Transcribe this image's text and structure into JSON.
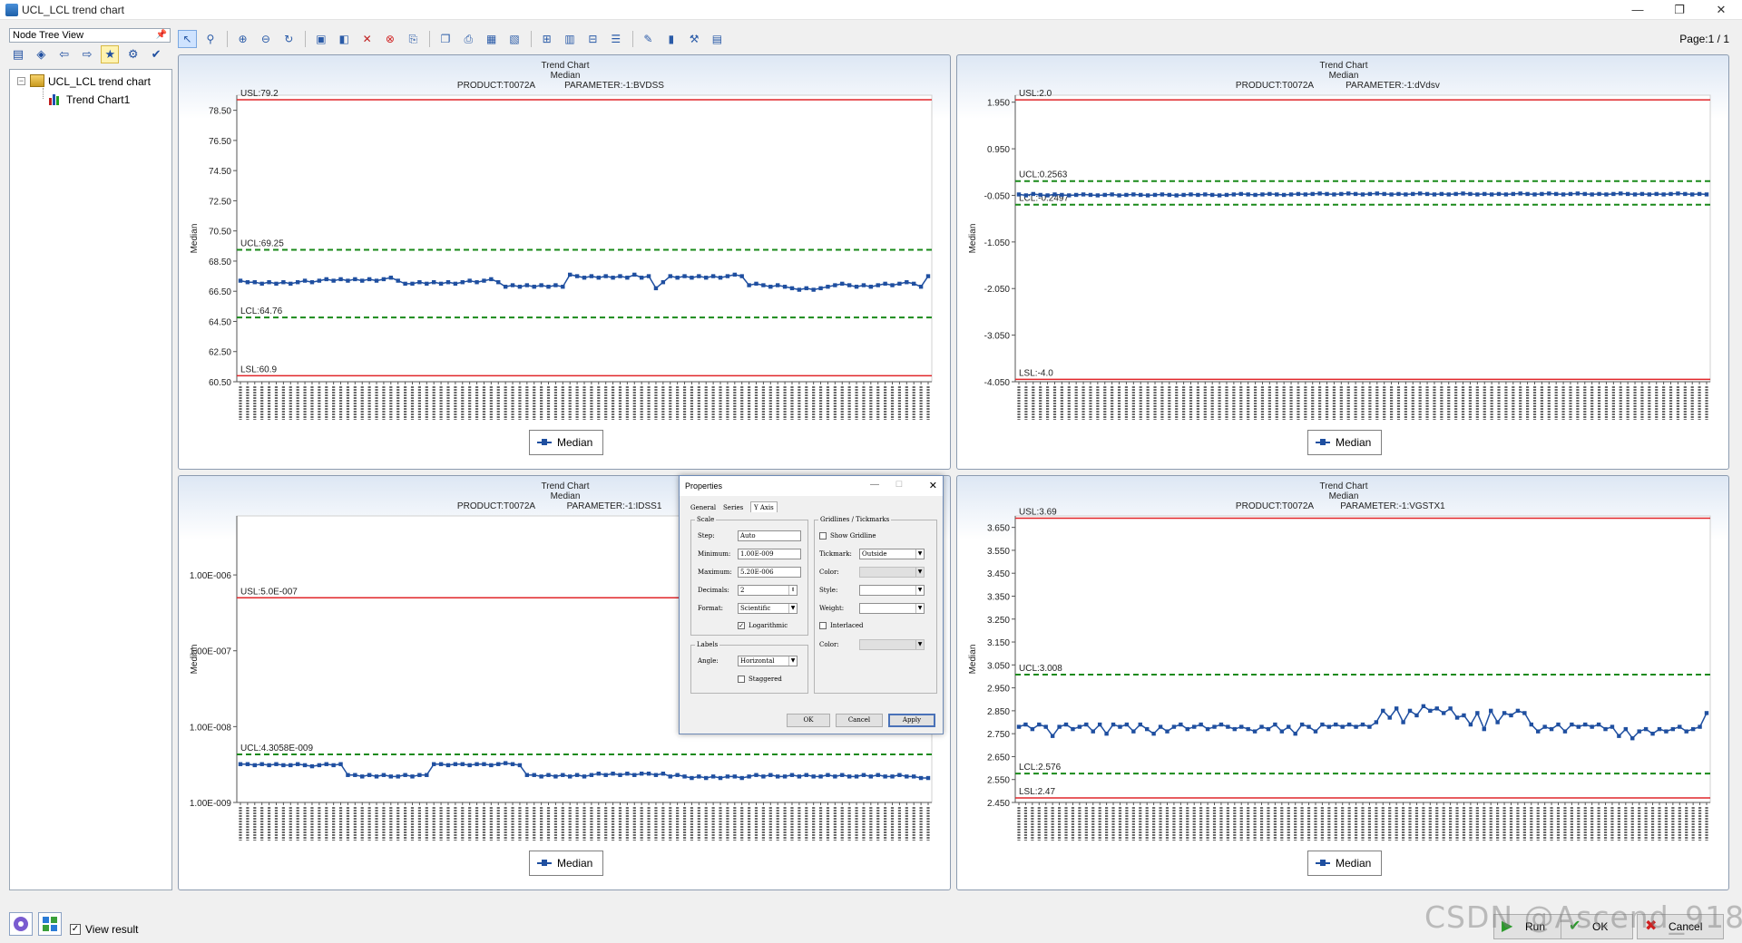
{
  "window": {
    "title": "UCL_LCL trend chart",
    "controls": [
      "—",
      "❐",
      "✕"
    ]
  },
  "tree": {
    "header": "Node Tree View",
    "pin": "📌",
    "root": "UCL_LCL trend chart",
    "child": "Trend Chart1",
    "expander": "−"
  },
  "page_label": "Page:1 / 1",
  "colors": {
    "usl": "#e0262a",
    "ucl": "#1a8a1a",
    "series": "#1f4fa0",
    "axis": "#333333"
  },
  "legend_label": "Median",
  "charts": [
    {
      "title": "Trend Chart",
      "subtitle": "Median",
      "product": "PRODUCT:T0072A",
      "parameter": "PARAMETER:-1:BVDSS",
      "ylabel": "Median",
      "yticks": [
        "78.50",
        "76.50",
        "74.50",
        "72.50",
        "70.50",
        "68.50",
        "66.50",
        "64.50",
        "62.50",
        "60.50"
      ],
      "labels": {
        "usl": "USL:79.2",
        "ucl": "UCL:69.25",
        "lcl": "LCL:64.76",
        "lsl": "LSL:60.9"
      }
    },
    {
      "title": "Trend Chart",
      "subtitle": "Median",
      "product": "PRODUCT:T0072A",
      "parameter": "PARAMETER:-1:dVdsv",
      "ylabel": "Median",
      "yticks": [
        "1.950",
        "0.950",
        "-0.050",
        "-1.050",
        "-2.050",
        "-3.050",
        "-4.050"
      ],
      "labels": {
        "usl": "USL:2.0",
        "ucl": "UCL:0.2563",
        "lcl": "LCL:-0.2497",
        "lsl": "LSL:-4.0"
      }
    },
    {
      "title": "Trend Chart",
      "subtitle": "Median",
      "product": "PRODUCT:T0072A",
      "parameter": "PARAMETER:-1:IDSS1",
      "ylabel": "Median",
      "yticks": [
        "1.00E-006",
        "1.00E-007",
        "1.00E-008",
        "1.00E-009"
      ],
      "labels": {
        "usl": "USL:5.0E-007",
        "ucl": "UCL:4.3058E-009",
        "lcl": "",
        "lsl": ""
      }
    },
    {
      "title": "Trend Chart",
      "subtitle": "Median",
      "product": "PRODUCT:T0072A",
      "parameter": "PARAMETER:-1:VGSTX1",
      "ylabel": "Median",
      "yticks": [
        "3.650",
        "3.550",
        "3.450",
        "3.350",
        "3.250",
        "3.150",
        "3.050",
        "2.950",
        "2.850",
        "2.750",
        "2.650",
        "2.550",
        "2.450"
      ],
      "labels": {
        "usl": "USL:3.69",
        "ucl": "UCL:3.008",
        "lcl": "LCL:2.576",
        "lsl": "LSL:2.47"
      }
    }
  ],
  "chart_data": [
    {
      "type": "line",
      "title": "Trend Chart",
      "subtitle": "Median",
      "ylabel": "Median",
      "ylim": [
        60.5,
        79.5
      ],
      "limits": {
        "usl": 79.2,
        "ucl": 69.25,
        "lcl": 64.76,
        "lsl": 60.9
      },
      "series": [
        {
          "name": "Median",
          "values": [
            67.2,
            67.1,
            67.1,
            67.0,
            67.1,
            67.0,
            67.1,
            67.0,
            67.1,
            67.2,
            67.1,
            67.2,
            67.3,
            67.2,
            67.3,
            67.2,
            67.3,
            67.2,
            67.3,
            67.2,
            67.3,
            67.4,
            67.2,
            67.0,
            67.0,
            67.1,
            67.0,
            67.1,
            67.0,
            67.1,
            67.0,
            67.1,
            67.2,
            67.1,
            67.2,
            67.3,
            67.1,
            66.8,
            66.9,
            66.8,
            66.9,
            66.8,
            66.9,
            66.8,
            66.9,
            66.8,
            67.6,
            67.5,
            67.4,
            67.5,
            67.4,
            67.5,
            67.4,
            67.5,
            67.4,
            67.6,
            67.4,
            67.5,
            66.7,
            67.1,
            67.5,
            67.4,
            67.5,
            67.4,
            67.5,
            67.4,
            67.5,
            67.4,
            67.5,
            67.6,
            67.5,
            66.9,
            67.0,
            66.9,
            66.8,
            66.9,
            66.8,
            66.7,
            66.6,
            66.7,
            66.6,
            66.7,
            66.8,
            66.9,
            67.0,
            66.9,
            66.8,
            66.9,
            66.8,
            66.9,
            67.0,
            66.9,
            67.0,
            67.1,
            67.0,
            66.8,
            67.5
          ]
        }
      ]
    },
    {
      "type": "line",
      "title": "Trend Chart",
      "subtitle": "Median",
      "ylabel": "Median",
      "ylim": [
        -4.05,
        2.1
      ],
      "limits": {
        "usl": 2.0,
        "ucl": 0.2563,
        "lcl": -0.2497,
        "lsl": -4.0
      },
      "series": [
        {
          "name": "Median",
          "values": [
            -0.03,
            -0.05,
            -0.02,
            -0.04,
            -0.05,
            -0.03,
            -0.04,
            -0.05,
            -0.04,
            -0.03,
            -0.04,
            -0.05,
            -0.04,
            -0.03,
            -0.05,
            -0.04,
            -0.03,
            -0.04,
            -0.05,
            -0.04,
            -0.03,
            -0.04,
            -0.05,
            -0.04,
            -0.03,
            -0.04,
            -0.03,
            -0.04,
            -0.05,
            -0.04,
            -0.03,
            -0.02,
            -0.03,
            -0.04,
            -0.03,
            -0.02,
            -0.03,
            -0.04,
            -0.03,
            -0.02,
            -0.03,
            -0.02,
            -0.01,
            -0.02,
            -0.03,
            -0.02,
            -0.01,
            -0.02,
            -0.03,
            -0.02,
            -0.01,
            -0.02,
            -0.03,
            -0.02,
            -0.03,
            -0.02,
            -0.01,
            -0.02,
            -0.03,
            -0.02,
            -0.03,
            -0.02,
            -0.01,
            -0.02,
            -0.03,
            -0.02,
            -0.03,
            -0.02,
            -0.03,
            -0.02,
            -0.01,
            -0.02,
            -0.03,
            -0.02,
            -0.01,
            -0.02,
            -0.03,
            -0.02,
            -0.01,
            -0.02,
            -0.03,
            -0.02,
            -0.03,
            -0.02,
            -0.01,
            -0.02,
            -0.03,
            -0.02,
            -0.03,
            -0.02,
            -0.03,
            -0.02,
            -0.01,
            -0.02,
            -0.03,
            -0.02,
            -0.03
          ]
        }
      ]
    },
    {
      "type": "line",
      "title": "Trend Chart",
      "subtitle": "Median",
      "ylabel": "Median",
      "yscale": "log",
      "ylim": [
        1e-09,
        6e-06
      ],
      "limits": {
        "usl": 5e-07,
        "ucl": 4.3058e-09
      },
      "series": [
        {
          "name": "Median",
          "values": [
            3.2e-09,
            3.2e-09,
            3.1e-09,
            3.2e-09,
            3.1e-09,
            3.2e-09,
            3.1e-09,
            3.1e-09,
            3.2e-09,
            3.1e-09,
            3e-09,
            3.1e-09,
            3.2e-09,
            3.1e-09,
            3.2e-09,
            2.3e-09,
            2.3e-09,
            2.2e-09,
            2.3e-09,
            2.2e-09,
            2.3e-09,
            2.2e-09,
            2.2e-09,
            2.3e-09,
            2.2e-09,
            2.3e-09,
            2.3e-09,
            3.2e-09,
            3.2e-09,
            3.1e-09,
            3.2e-09,
            3.2e-09,
            3.1e-09,
            3.2e-09,
            3.2e-09,
            3.1e-09,
            3.2e-09,
            3.3e-09,
            3.2e-09,
            3.1e-09,
            2.3e-09,
            2.3e-09,
            2.2e-09,
            2.3e-09,
            2.2e-09,
            2.3e-09,
            2.2e-09,
            2.3e-09,
            2.2e-09,
            2.3e-09,
            2.4e-09,
            2.3e-09,
            2.4e-09,
            2.3e-09,
            2.4e-09,
            2.3e-09,
            2.4e-09,
            2.4e-09,
            2.3e-09,
            2.4e-09,
            2.2e-09,
            2.3e-09,
            2.2e-09,
            2.1e-09,
            2.2e-09,
            2.1e-09,
            2.2e-09,
            2.1e-09,
            2.2e-09,
            2.2e-09,
            2.1e-09,
            2.2e-09,
            2.3e-09,
            2.2e-09,
            2.3e-09,
            2.2e-09,
            2.2e-09,
            2.3e-09,
            2.2e-09,
            2.3e-09,
            2.2e-09,
            2.2e-09,
            2.3e-09,
            2.2e-09,
            2.3e-09,
            2.2e-09,
            2.2e-09,
            2.3e-09,
            2.2e-09,
            2.3e-09,
            2.2e-09,
            2.2e-09,
            2.3e-09,
            2.2e-09,
            2.2e-09,
            2.1e-09,
            2.1e-09
          ]
        }
      ]
    },
    {
      "type": "line",
      "title": "Trend Chart",
      "subtitle": "Median",
      "ylabel": "Median",
      "ylim": [
        2.45,
        3.7
      ],
      "limits": {
        "usl": 3.69,
        "ucl": 3.008,
        "lcl": 2.576,
        "lsl": 2.47
      },
      "series": [
        {
          "name": "Median",
          "values": [
            2.78,
            2.79,
            2.77,
            2.79,
            2.78,
            2.74,
            2.78,
            2.79,
            2.77,
            2.78,
            2.79,
            2.76,
            2.79,
            2.75,
            2.79,
            2.78,
            2.79,
            2.76,
            2.79,
            2.77,
            2.75,
            2.78,
            2.76,
            2.78,
            2.79,
            2.77,
            2.78,
            2.79,
            2.77,
            2.78,
            2.79,
            2.78,
            2.77,
            2.78,
            2.77,
            2.76,
            2.78,
            2.77,
            2.79,
            2.76,
            2.78,
            2.75,
            2.79,
            2.78,
            2.76,
            2.79,
            2.78,
            2.79,
            2.78,
            2.79,
            2.78,
            2.79,
            2.78,
            2.8,
            2.85,
            2.82,
            2.86,
            2.8,
            2.85,
            2.83,
            2.87,
            2.85,
            2.86,
            2.84,
            2.86,
            2.82,
            2.83,
            2.79,
            2.84,
            2.77,
            2.85,
            2.8,
            2.84,
            2.83,
            2.85,
            2.84,
            2.79,
            2.76,
            2.78,
            2.77,
            2.79,
            2.76,
            2.79,
            2.78,
            2.79,
            2.78,
            2.79,
            2.77,
            2.78,
            2.74,
            2.77,
            2.73,
            2.76,
            2.77,
            2.75,
            2.77,
            2.76,
            2.77,
            2.78,
            2.76,
            2.77,
            2.78,
            2.84
          ]
        }
      ]
    }
  ],
  "dialog": {
    "title": "Properties",
    "tabs": [
      "General",
      "Series",
      "Y Axis"
    ],
    "scale_group": "Scale",
    "step_label": "Step:",
    "step_value": "Auto",
    "min_label": "Minimum:",
    "min_value": "1.00E-009",
    "max_label": "Maximum:",
    "max_value": "5.20E-006",
    "dec_label": "Decimals:",
    "dec_value": "2",
    "fmt_label": "Format:",
    "fmt_value": "Scientific",
    "log_label": "Logarithmic",
    "log_checked": "✓",
    "labels_group": "Labels",
    "angle_label": "Angle:",
    "angle_value": "Horizontal",
    "stagger_label": "Staggered",
    "grid_group": "Gridlines / Tickmarks",
    "show_grid_label": "Show Gridline",
    "tick_label": "Tickmark:",
    "tick_value": "Outside",
    "color_label": "Color:",
    "style_label": "Style:",
    "weight_label": "Weight:",
    "interlaced_label": "Interlaced",
    "color2_label": "Color:",
    "ok": "OK",
    "cancel": "Cancel",
    "apply": "Apply",
    "close": "✕",
    "min": "—",
    "max": "☐"
  },
  "bottom": {
    "view_result": "View result",
    "view_checked": "✓",
    "run": "Run",
    "ok": "OK",
    "cancel": "Cancel"
  },
  "watermark": "CSDN @Ascend_918"
}
